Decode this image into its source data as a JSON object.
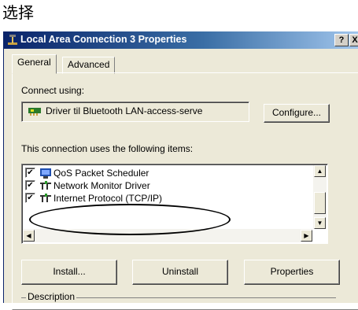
{
  "caption": "选择",
  "window": {
    "title": "Local Area Connection 3 Properties",
    "help_button": "?",
    "close_button": "X"
  },
  "tabs": [
    {
      "label": "General",
      "active": true
    },
    {
      "label": "Advanced",
      "active": false
    }
  ],
  "connect_using": {
    "label": "Connect using:",
    "adapter": "Driver til Bluetooth LAN-access-serve",
    "configure_button": "Configure..."
  },
  "items_section": {
    "label": "This connection uses the following items:",
    "items": [
      {
        "label": "QoS Packet Scheduler",
        "checked": true,
        "icon": "scheduler-icon"
      },
      {
        "label": "Network Monitor Driver",
        "checked": true,
        "icon": "network-protocol-icon"
      },
      {
        "label": "Internet Protocol (TCP/IP)",
        "checked": true,
        "icon": "network-protocol-icon"
      }
    ]
  },
  "buttons": {
    "install": "Install...",
    "uninstall": "Uninstall",
    "properties": "Properties"
  },
  "description": {
    "label": "Description"
  },
  "check_glyph": "✔",
  "scroll": {
    "up": "▲",
    "down": "▼",
    "left": "◀",
    "right": "▶"
  }
}
